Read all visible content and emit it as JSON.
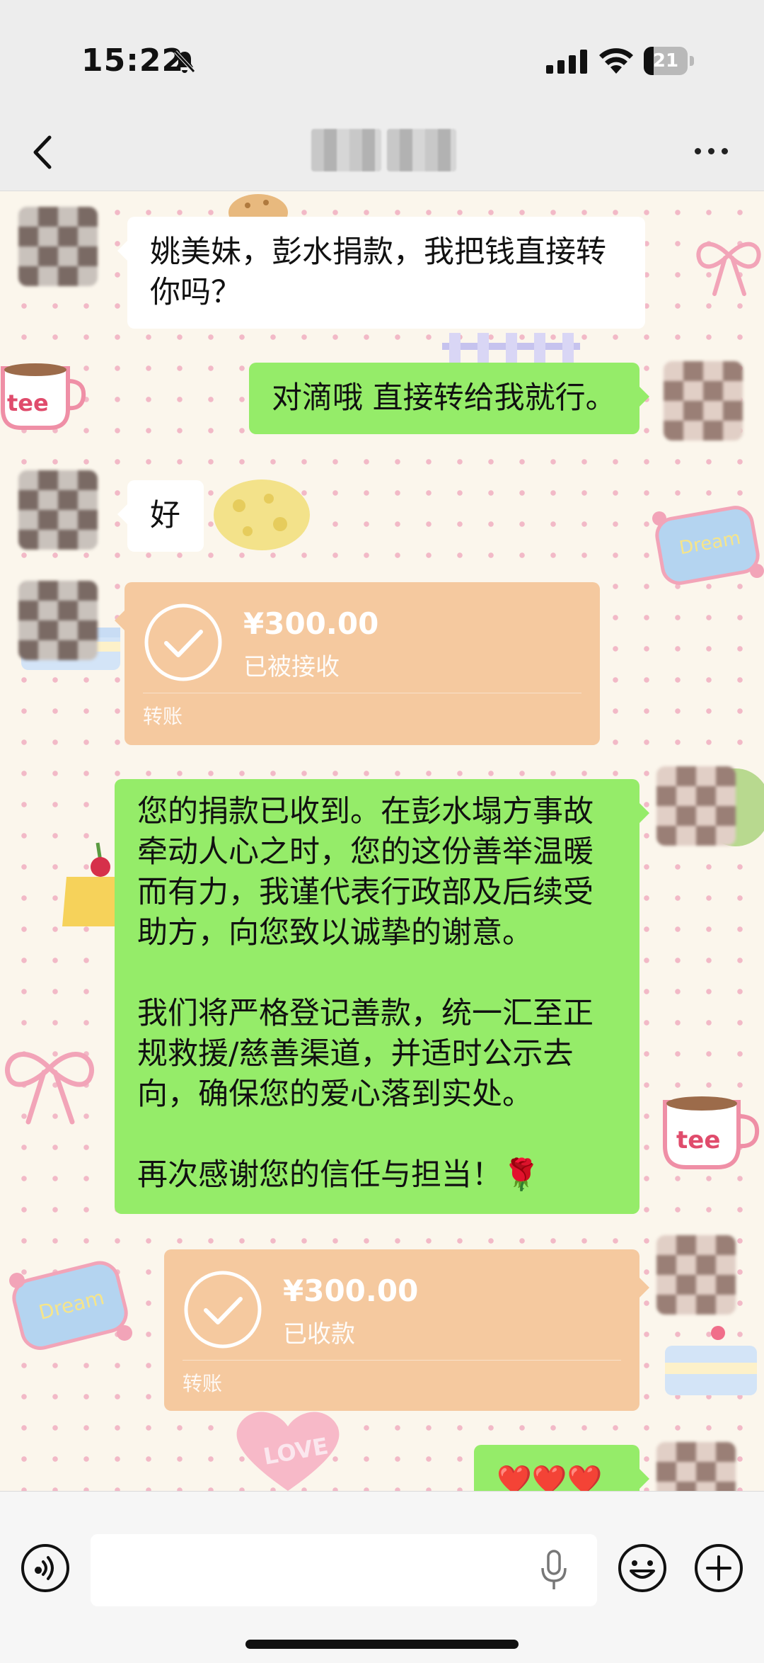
{
  "status_bar": {
    "time": "15:22",
    "battery": "21"
  },
  "nav": {
    "back_icon": "chevron-left-icon",
    "more_icon": "more-horizontal-icon"
  },
  "messages": [
    {
      "side": "in",
      "type": "text",
      "text": "姚美妹，彭水捐款，我把钱直接转你吗？",
      "lines": [
        "姚美妹，彭水捐款，我把钱直接转",
        "你吗？"
      ]
    },
    {
      "side": "out",
      "type": "text",
      "text": "对滴哦 直接转给我就行。"
    },
    {
      "side": "in",
      "type": "text",
      "text": "好"
    },
    {
      "side": "in",
      "type": "transfer",
      "amount": "¥300.00",
      "status": "已被接收",
      "label": "转账"
    },
    {
      "side": "out",
      "type": "text",
      "text": "您的捐款已收到。在彭水塌方事故\n牵动人心之时，您的这份善举温暖\n而有力，我谨代表行政部及后续受\n助方，向您致以诚挚的谢意。\n\n我们将严格登记善款，统一汇至正\n规救援/慈善渠道，并适时公示去\n向，确保您的爱心落到实处。\n\n再次感谢您的信任与担当！🌹"
    },
    {
      "side": "out",
      "type": "transfer",
      "amount": "¥300.00",
      "status": "已收款",
      "label": "转账"
    },
    {
      "side": "out",
      "type": "text",
      "text": "❤️❤️❤️"
    }
  ],
  "stickers": {
    "cup": "tee",
    "pillow": "Dream",
    "heart": "LOVE"
  },
  "input_bar": {
    "voice_icon": "voice-icon",
    "mic_icon": "mic-icon",
    "emoji_icon": "emoji-icon",
    "plus_icon": "plus-icon"
  },
  "colors": {
    "outgoing_bubble": "#95ec69",
    "incoming_bubble": "#ffffff",
    "transfer_card": "#f5c99f",
    "chat_background": "#fbf6ec"
  }
}
